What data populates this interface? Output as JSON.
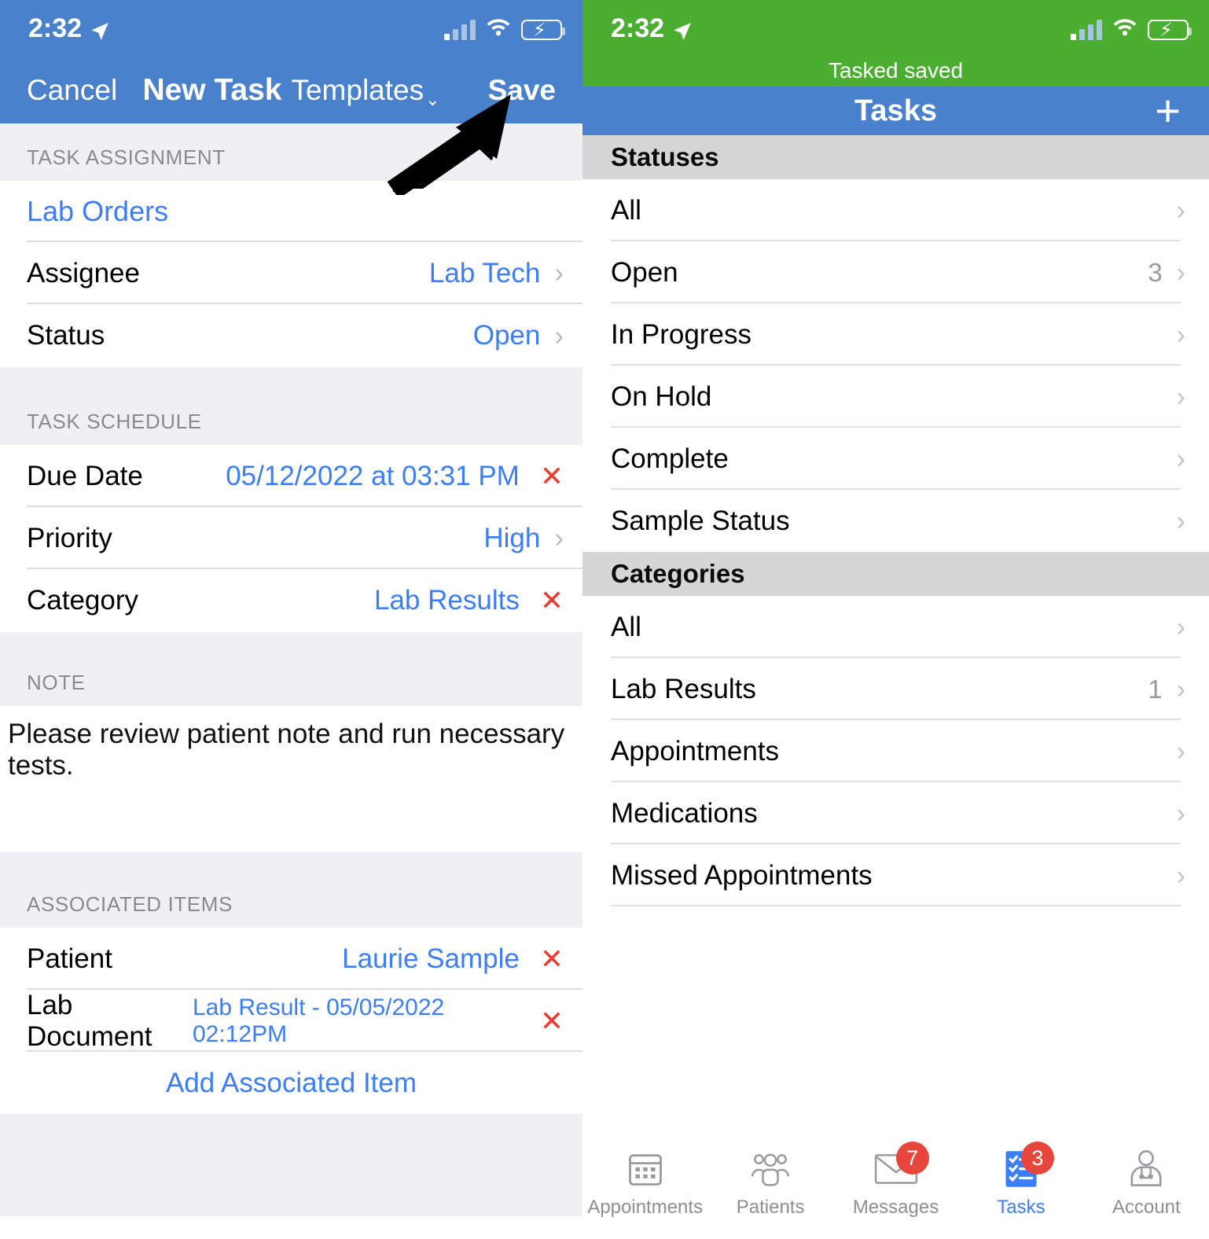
{
  "left": {
    "status_bar": {
      "time": "2:32",
      "location_icon": "location-arrow-icon",
      "wifi_icon": "wifi-icon",
      "battery_icon": "battery-charging-icon",
      "signal_icon": "cellular-signal-icon"
    },
    "nav": {
      "cancel": "Cancel",
      "title": "New Task",
      "templates": "Templates",
      "templates_chevron": "⌄",
      "save": "Save"
    },
    "sections": [
      {
        "header": "TASK ASSIGNMENT",
        "rows": [
          {
            "kind": "link",
            "label": "Lab Orders"
          },
          {
            "kind": "value",
            "label": "Assignee",
            "value": "Lab Tech",
            "accessory": "chevron"
          },
          {
            "kind": "value",
            "label": "Status",
            "value": "Open",
            "accessory": "chevron"
          }
        ]
      },
      {
        "header": "TASK SCHEDULE",
        "rows": [
          {
            "kind": "value",
            "label": "Due Date",
            "value": "05/12/2022 at 03:31 PM",
            "accessory": "clear"
          },
          {
            "kind": "value",
            "label": "Priority",
            "value": "High",
            "accessory": "chevron"
          },
          {
            "kind": "value",
            "label": "Category",
            "value": "Lab Results",
            "accessory": "clear"
          }
        ]
      },
      {
        "header": "NOTE",
        "note": "Please review patient note and run necessary tests."
      },
      {
        "header": "ASSOCIATED ITEMS",
        "rows": [
          {
            "kind": "value",
            "label": "Patient",
            "value": "Laurie Sample",
            "accessory": "clear"
          },
          {
            "kind": "value",
            "label": "Lab Document",
            "value": "Lab Result - 05/05/2022 02:12PM",
            "accessory": "clear",
            "small": true
          }
        ],
        "action": "Add Associated Item"
      }
    ],
    "annotation": {
      "type": "arrow",
      "points_to": "save-button"
    }
  },
  "right": {
    "status_bar": {
      "time": "2:32",
      "location_icon": "location-arrow-icon",
      "wifi_icon": "wifi-icon",
      "battery_icon": "battery-charging-icon",
      "signal_icon": "cellular-signal-icon"
    },
    "toast": "Tasked saved",
    "nav": {
      "title": "Tasks",
      "add_icon": "plus-icon"
    },
    "groups": [
      {
        "header": "Statuses",
        "rows": [
          {
            "label": "All",
            "count": ""
          },
          {
            "label": "Open",
            "count": "3"
          },
          {
            "label": "In Progress",
            "count": ""
          },
          {
            "label": "On Hold",
            "count": ""
          },
          {
            "label": "Complete",
            "count": ""
          },
          {
            "label": "Sample Status",
            "count": ""
          }
        ]
      },
      {
        "header": "Categories",
        "rows": [
          {
            "label": "All",
            "count": ""
          },
          {
            "label": "Lab Results",
            "count": "1"
          },
          {
            "label": "Appointments",
            "count": ""
          },
          {
            "label": "Medications",
            "count": ""
          },
          {
            "label": "Missed Appointments",
            "count": ""
          }
        ]
      }
    ],
    "tabs": [
      {
        "label": "Appointments",
        "icon": "calendar-icon",
        "badge": "",
        "active": false
      },
      {
        "label": "Patients",
        "icon": "people-icon",
        "badge": "",
        "active": false
      },
      {
        "label": "Messages",
        "icon": "envelope-icon",
        "badge": "7",
        "active": false
      },
      {
        "label": "Tasks",
        "icon": "checklist-icon",
        "badge": "3",
        "active": true
      },
      {
        "label": "Account",
        "icon": "doctor-icon",
        "badge": "",
        "active": false
      }
    ]
  },
  "colors": {
    "nav_blue": "#4a81cd",
    "toast_green": "#4cae31",
    "link_blue": "#3b7ef7",
    "destructive_red": "#ee3b2f",
    "badge_red": "#e8453c",
    "group_header_gray": "#d6d6d6",
    "section_header_gray": "#f0f0f3"
  }
}
